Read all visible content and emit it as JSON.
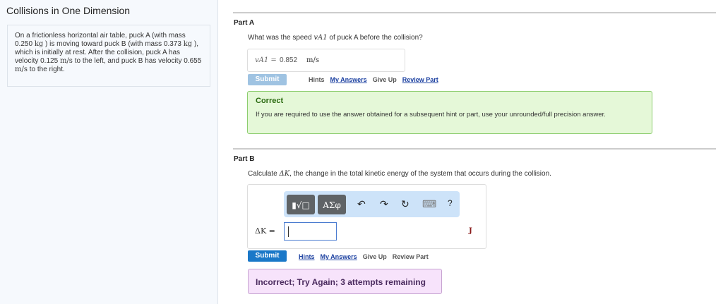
{
  "title": "Collisions in One Dimension",
  "problem": {
    "p1": "On a frictionless horizontal air table, puck A (with mass 0.250 ",
    "kg": "kg",
    "p2": " ) is moving toward puck B (with mass 0.373 ",
    "p3": " ), which is initially at rest. After the collision, puck A has velocity 0.125 ",
    "ms": "m/s",
    "p4": " to the left, and puck B has velocity 0.655 ",
    "p5": " to the right."
  },
  "partA": {
    "label": "Part A",
    "q1": "What was the speed ",
    "var": "vA1",
    "q2": " of puck A before the collision?",
    "ans_label": "vA1 =",
    "ans_value": "0.852",
    "ans_unit": "m/s",
    "submit": "Submit",
    "links": {
      "hints": "Hints",
      "my_answers": "My Answers",
      "give_up": "Give Up",
      "review": "Review Part"
    },
    "feedback_title": "Correct",
    "feedback_text": "If you are required to use the answer obtained for a subsequent hint or part, use your unrounded/full precision answer."
  },
  "partB": {
    "label": "Part B",
    "q1": "Calculate ",
    "var": "ΔK",
    "q2": ", the change in the total kinetic energy of the system that occurs during the collision.",
    "toolbar": {
      "templates": "▮√□",
      "symbols": "ΑΣφ",
      "undo": "↶",
      "redo": "↷",
      "reset": "↻",
      "keyboard": "⌨",
      "help": "?"
    },
    "ans_label": "ΔK =",
    "ans_value": "",
    "ans_unit": "J",
    "submit": "Submit",
    "links": {
      "hints": "Hints",
      "my_answers": "My Answers",
      "give_up": "Give Up",
      "review": "Review Part"
    },
    "feedback": "Incorrect; Try Again; 3 attempts remaining"
  }
}
